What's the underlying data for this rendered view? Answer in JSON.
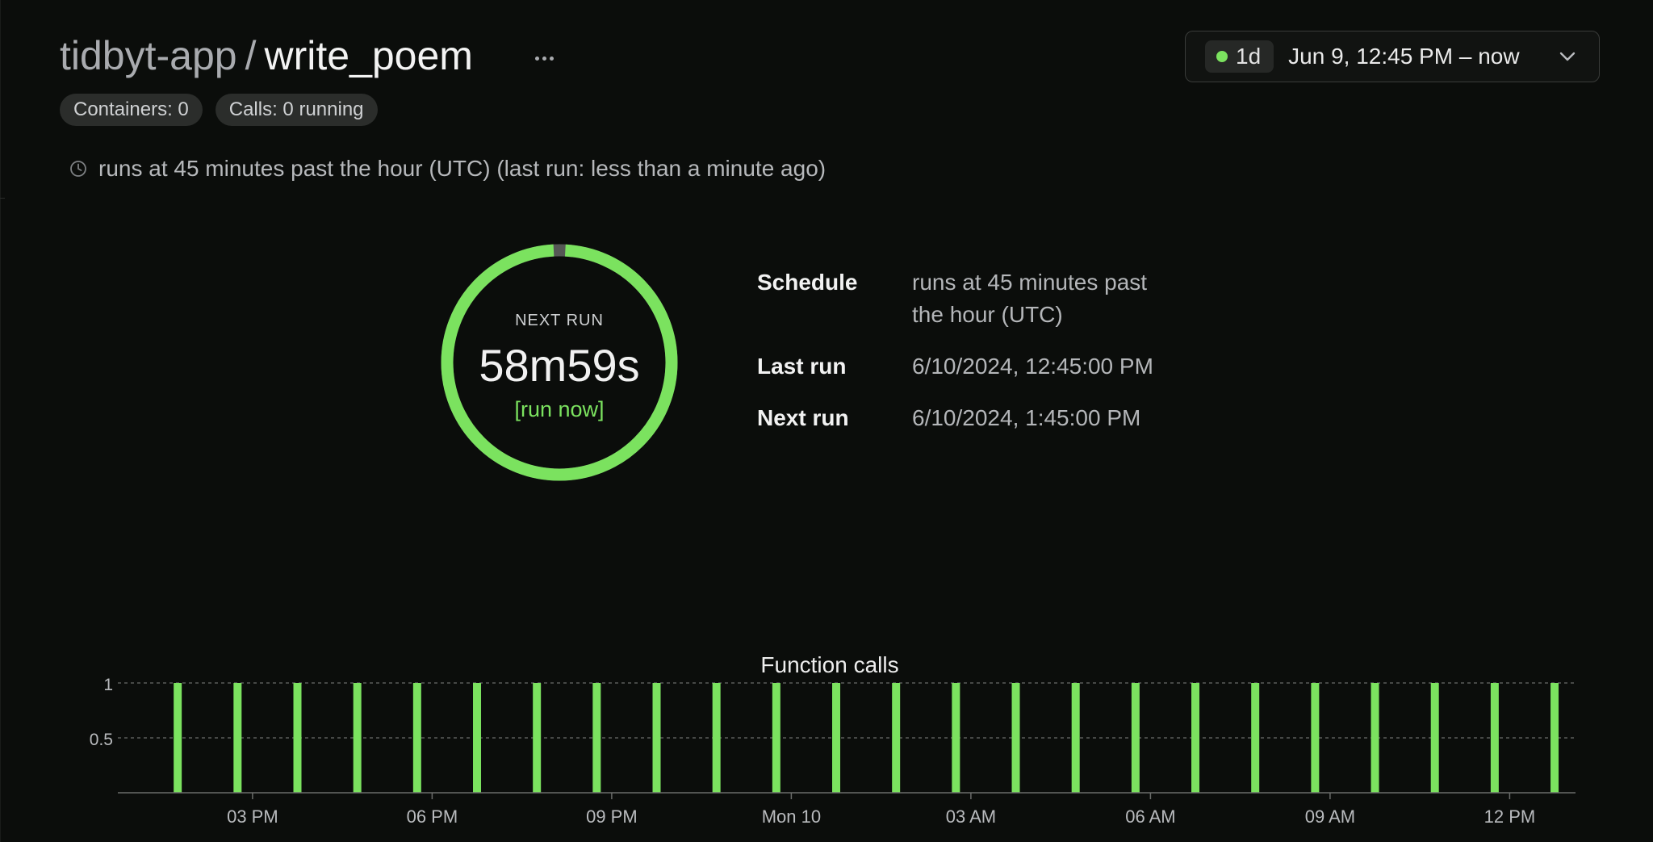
{
  "header": {
    "app_name": "tidbyt-app",
    "separator": "/",
    "function_name": "write_poem",
    "more_label": "···"
  },
  "badges": {
    "containers": "Containers: 0",
    "calls": "Calls: 0 running"
  },
  "time_range": {
    "preset": "1d",
    "label": "Jun 9, 12:45 PM – now",
    "accent": "#7be25f"
  },
  "schedule_summary": "runs at 45 minutes past the hour (UTC) (last run: less than a minute ago)",
  "next_run_widget": {
    "caption": "NEXT RUN",
    "countdown": "58m59s",
    "action": "[run now]",
    "progress_remaining": 0.983
  },
  "details": [
    {
      "label": "Schedule",
      "value_lines": [
        "runs at 45 minutes past",
        "the hour (UTC)"
      ]
    },
    {
      "label": "Last run",
      "value_lines": [
        "6/10/2024, 12:45:00 PM"
      ]
    },
    {
      "label": "Next run",
      "value_lines": [
        "6/10/2024, 1:45:00 PM"
      ]
    }
  ],
  "chart_data": {
    "type": "bar",
    "title": "Function calls",
    "xlabel": "",
    "ylabel": "",
    "y_ticks": [
      "0.5",
      "1"
    ],
    "ylim": [
      0,
      1
    ],
    "x_ticks": [
      "03 PM",
      "06 PM",
      "09 PM",
      "Mon 10",
      "03 AM",
      "06 AM",
      "09 AM",
      "12 PM"
    ],
    "x_tick_hours": [
      15,
      18,
      21,
      24,
      27,
      30,
      33,
      36
    ],
    "x_range_hours": [
      12.75,
      37.1
    ],
    "series": [
      {
        "color": "#7be25f",
        "x_hours": [
          13.75,
          14.75,
          15.75,
          16.75,
          17.75,
          18.75,
          19.75,
          20.75,
          21.75,
          22.75,
          23.75,
          24.75,
          25.75,
          26.75,
          27.75,
          28.75,
          29.75,
          30.75,
          31.75,
          32.75,
          33.75,
          34.75,
          35.75,
          36.75
        ],
        "values": [
          1,
          1,
          1,
          1,
          1,
          1,
          1,
          1,
          1,
          1,
          1,
          1,
          1,
          1,
          1,
          1,
          1,
          1,
          1,
          1,
          1,
          1,
          1,
          1
        ]
      }
    ],
    "grid": true
  }
}
